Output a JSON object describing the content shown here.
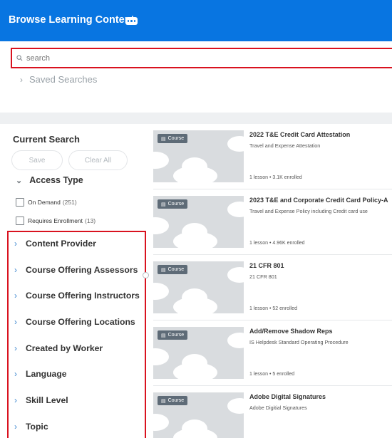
{
  "header": {
    "title": "Browse Learning Content"
  },
  "search": {
    "placeholder": "search",
    "value": "search"
  },
  "saved_searches": {
    "label": "Saved Searches"
  },
  "sidebar": {
    "current_search_title": "Current Search",
    "save_label": "Save",
    "clear_all_label": "Clear All",
    "access_type": {
      "label": "Access Type",
      "options": [
        {
          "label": "On Demand",
          "count": "(251)"
        },
        {
          "label": "Requires Enrollment",
          "count": "(13)"
        }
      ]
    },
    "facets": [
      "Content Provider",
      "Course Offering Assessors",
      "Course Offering Instructors",
      "Course Offering Locations",
      "Created by Worker",
      "Language",
      "Skill Level",
      "Topic"
    ]
  },
  "results": [
    {
      "badge": "Course",
      "title": "2022 T&E Credit Card Attestation",
      "description": "Travel and Expense Attestation",
      "meta": "1 lesson  •  3.1K enrolled"
    },
    {
      "badge": "Course",
      "title": "2023 T&E and Corporate Credit Card Policy-A",
      "description": "Travel and Expense Policy including Credit card use",
      "meta": "1 lesson  •  4.96K enrolled"
    },
    {
      "badge": "Course",
      "title": "21 CFR 801",
      "description": "21 CFR 801",
      "meta": "1 lesson  •  52 enrolled"
    },
    {
      "badge": "Course",
      "title": "Add/Remove Shadow Reps",
      "description": "IS Helpdesk Standard Operating Procedure",
      "meta": "1 lesson  •  5 enrolled"
    },
    {
      "badge": "Course",
      "title": "Adobe Digital Signatures",
      "description": "Adobe Digitial Signatures",
      "meta": ""
    }
  ],
  "colors": {
    "header": "#0875e1",
    "highlight": "#d9121f",
    "accent": "#3f88d0"
  }
}
